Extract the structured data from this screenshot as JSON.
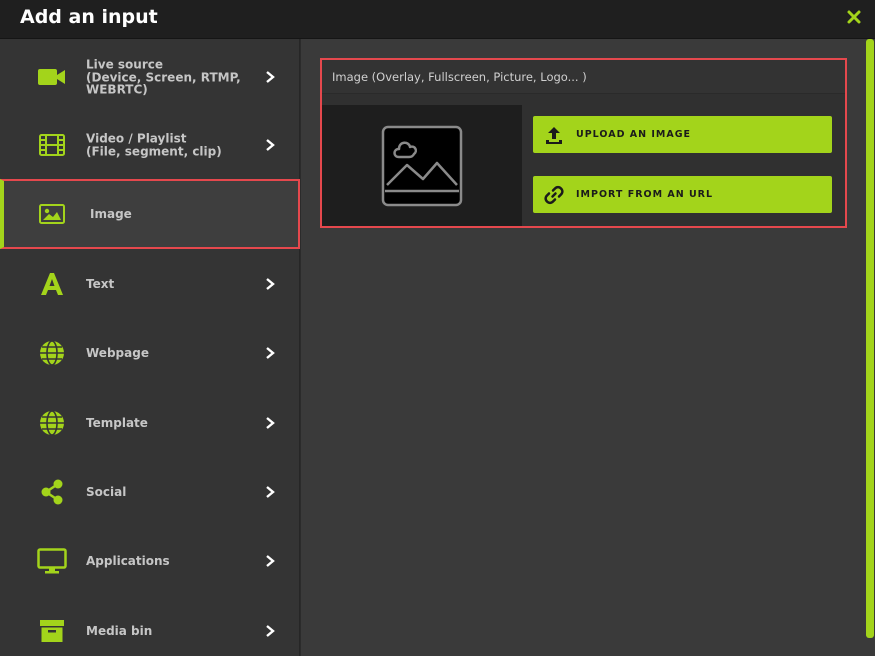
{
  "window": {
    "title": "Add an input"
  },
  "colors": {
    "accent": "#a3d41b",
    "highlight": "#e5484d",
    "bg": "#2b2b2b"
  },
  "sidebar": {
    "items": [
      {
        "label": "Live source\n(Device, Screen, RTMP,\nWEBRTC)",
        "icon": "video-camera-icon",
        "chevron": true
      },
      {
        "label": "Video / Playlist\n(File, segment, clip)",
        "icon": "film-icon",
        "chevron": true
      },
      {
        "label": "Image",
        "icon": "image-icon",
        "chevron": false,
        "active": true
      },
      {
        "label": "Text",
        "icon": "text-a-icon",
        "chevron": true
      },
      {
        "label": "Webpage",
        "icon": "globe-icon",
        "chevron": true
      },
      {
        "label": "Template",
        "icon": "globe-icon",
        "chevron": true
      },
      {
        "label": "Social",
        "icon": "share-icon",
        "chevron": true
      },
      {
        "label": "Applications",
        "icon": "monitor-icon",
        "chevron": true
      },
      {
        "label": "Media bin",
        "icon": "archive-icon",
        "chevron": true
      }
    ]
  },
  "panel": {
    "title": "Image (Overlay, Fullscreen, Picture, Logo... )",
    "upload_label": "UPLOAD AN IMAGE",
    "import_label": "IMPORT FROM AN URL"
  }
}
